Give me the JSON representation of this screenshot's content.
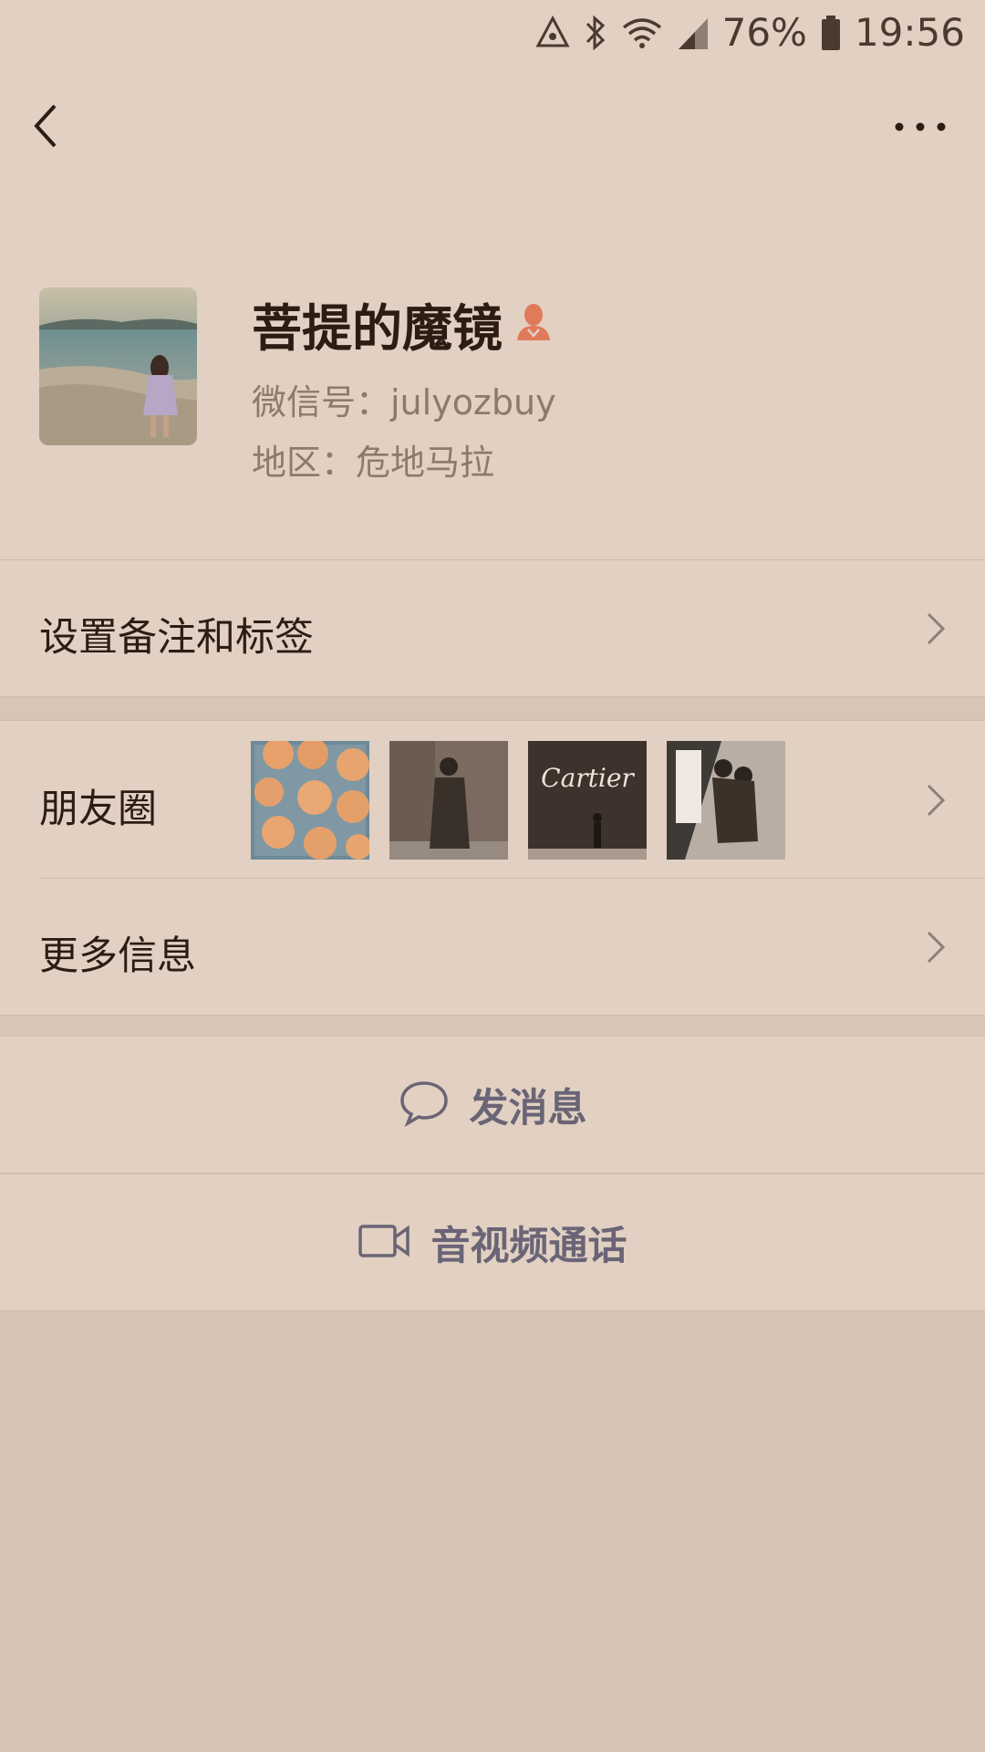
{
  "status_bar": {
    "battery": "76%",
    "time": "19:56",
    "icons": [
      "nfc-icon",
      "bluetooth-icon",
      "wifi-icon",
      "signal-icon",
      "battery-icon"
    ]
  },
  "nav": {
    "back_icon": "chevron-left-icon",
    "more_icon": "more-dots-icon"
  },
  "profile": {
    "name": "菩提的魔镜",
    "gender_icon": "female-user-icon",
    "wechat_id": "微信号：julyozbuy",
    "region": "地区：危地马拉"
  },
  "rows": {
    "remark_label": "设置备注和标签",
    "moments_label": "朋友圈",
    "more_info_label": "更多信息"
  },
  "moments_thumbs": {
    "cartier_text": "Cartier"
  },
  "actions": {
    "message_label": "发消息",
    "call_label": "音视频通话"
  },
  "colors": {
    "background": "#e2d1c2",
    "text_primary": "#2b1d14",
    "text_secondary": "#8c7a6c",
    "action_text": "#6a6476",
    "gender_icon": "#e07a5a"
  }
}
